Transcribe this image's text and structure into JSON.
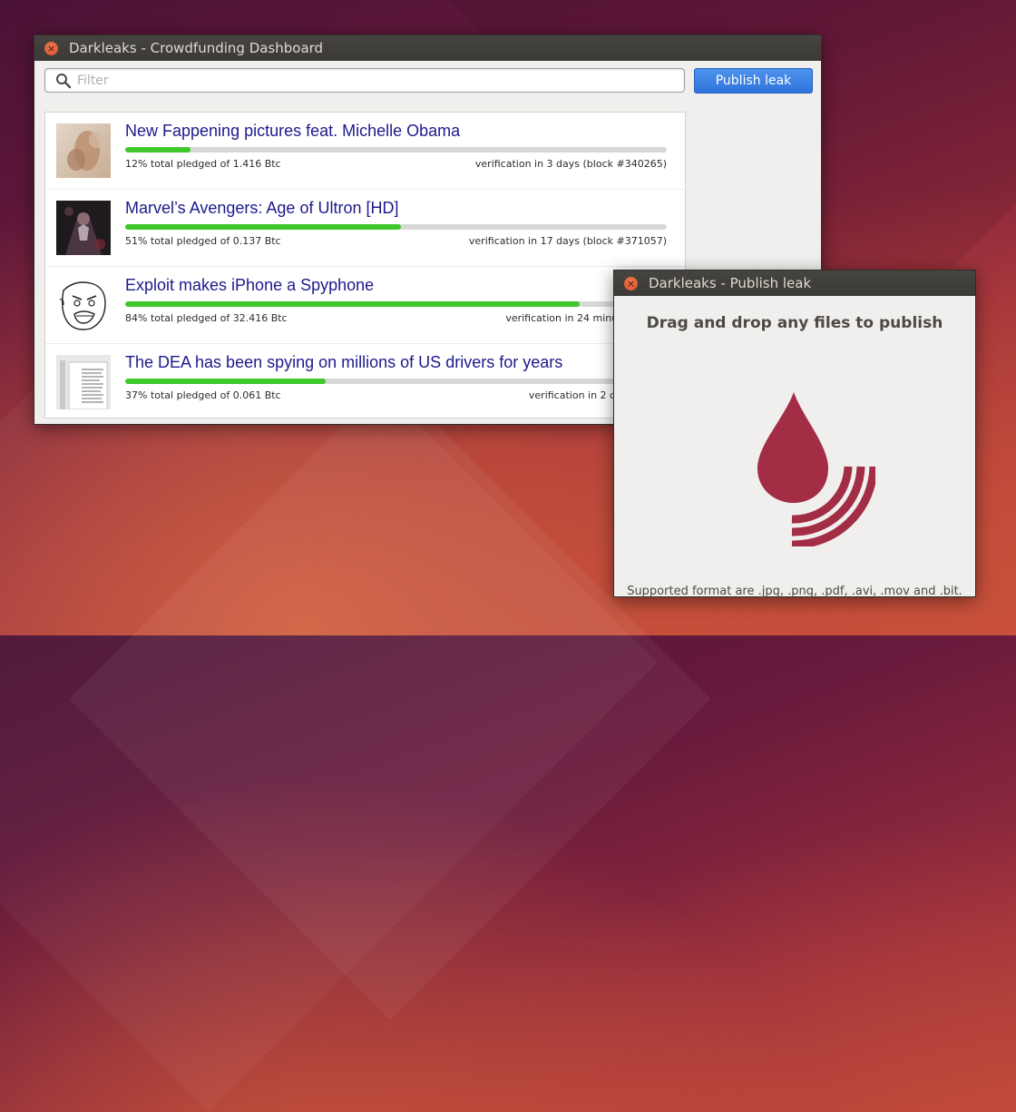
{
  "dashboard": {
    "title": "Darkleaks - Crowdfunding Dashboard",
    "filter_placeholder": "Filter",
    "publish_button": "Publish leak",
    "items": [
      {
        "title": "New Fappening pictures feat. Michelle Obama",
        "progress": 0.12,
        "pledged": "12% total pledged of 1.416 Btc",
        "verification": "verification in 3 days (block #340265)",
        "thumb_icon": "photo-thumbnail"
      },
      {
        "title": "Marvel’s Avengers: Age of Ultron [HD]",
        "progress": 0.51,
        "pledged": "51% total pledged of 0.137 Btc",
        "verification": "verification in 17 days (block #371057)",
        "thumb_icon": "movie-poster-thumbnail"
      },
      {
        "title": "Exploit makes iPhone a Spyphone",
        "progress": 0.84,
        "pledged": "84% total pledged of 32.416 Btc",
        "verification": "verification in 24 minutes (block",
        "thumb_icon": "rage-face-thumbnail"
      },
      {
        "title": "The DEA has been spying on millions of US drivers for years",
        "progress": 0.37,
        "pledged": "37% total pledged of 0.061 Btc",
        "verification": "verification in 2 days (block",
        "thumb_icon": "document-thumbnail"
      }
    ]
  },
  "publish_dialog": {
    "title": "Darkleaks - Publish leak",
    "heading": "Drag and drop any files to publish",
    "note": "Supported format are .jpg, .png, .pdf, .avi, .mov and .bit.",
    "logo_icon": "droplet-wave-icon",
    "logo_color": "#a22d45"
  },
  "colors": {
    "progress_fill": "#3fc82b",
    "title_text": "#1c1a8c",
    "button_blue": "#3a80e4",
    "close_button": "#e2583a"
  }
}
